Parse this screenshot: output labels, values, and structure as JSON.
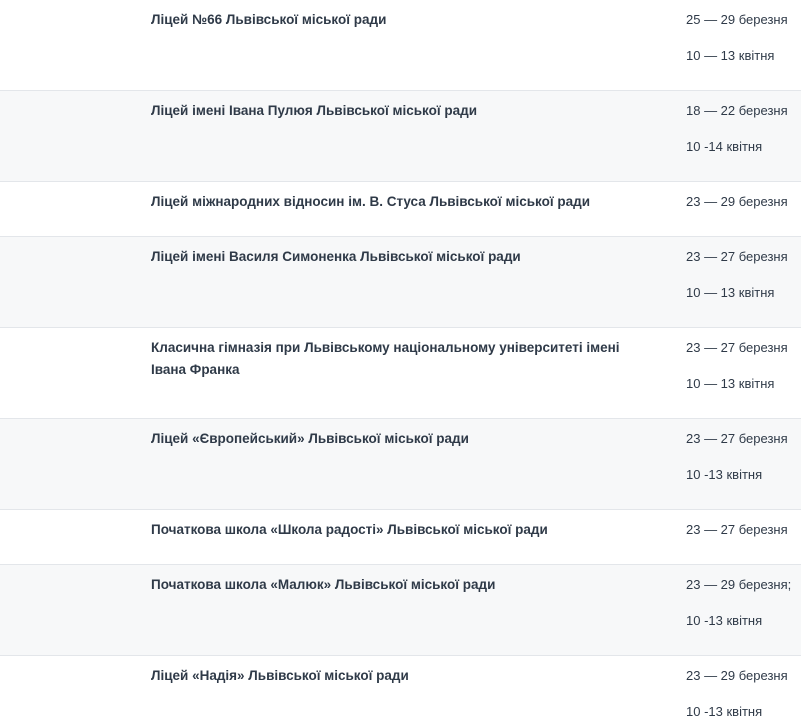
{
  "rows": [
    {
      "name": "Ліцей №66 Львівської міської ради",
      "dates": [
        "25 — 29 березня",
        "10 — 13 квітня"
      ]
    },
    {
      "name": "Ліцей імені Івана Пулюя Львівської міської ради",
      "dates": [
        "18 — 22 березня",
        "10 -14 квітня"
      ]
    },
    {
      "name": "Ліцей міжнародних відносин ім. В. Стуса Львівської міської ради",
      "dates": [
        "23 — 29 березня"
      ]
    },
    {
      "name": "Ліцей імені Василя Симоненка Львівської міської ради",
      "dates": [
        "23 — 27 березня",
        "10 — 13 квітня"
      ]
    },
    {
      "name": "Класична гімназія при Львівському національному університеті імені Івана Франка",
      "dates": [
        "23 — 27 березня",
        "10 — 13 квітня"
      ]
    },
    {
      "name": "Ліцей «Європейський» Львівської міської ради",
      "dates": [
        "23 — 27 березня",
        "10 -13 квітня"
      ]
    },
    {
      "name": "Початкова школа «Школа радості» Львівської міської ради",
      "dates": [
        "23 — 27 березня"
      ]
    },
    {
      "name": "Початкова школа «Малюк» Львівської міської ради",
      "dates": [
        "23 — 29 березня;",
        "10 -13 квітня"
      ]
    },
    {
      "name": "Ліцей «Надія» Львівської міської ради",
      "dates": [
        "23 — 29 березня",
        "10 -13 квітня"
      ]
    }
  ]
}
